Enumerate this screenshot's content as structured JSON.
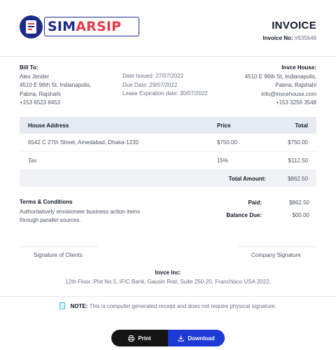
{
  "brand": {
    "name_dark": "SIM",
    "name_red": "ARSIP"
  },
  "invoice": {
    "title": "INVOICE",
    "number_label": "Invoice No:",
    "number": "#935648"
  },
  "bill_to": {
    "heading": "Bill To:",
    "lines": [
      "Alex Jender",
      "4510 E 96th St, Indianapolis,",
      "Pabna, Rajshahi",
      "+153 6523 8453"
    ]
  },
  "dates": {
    "lines": [
      "Date Issued: 27/07/2022",
      "Due Date: 29/07/2022",
      "Lease Expiration date: 30/07/2022"
    ]
  },
  "from": {
    "heading": "Invce House:",
    "lines": [
      "4510 E 96th St, Indianapolis,",
      "Pabna, Rajshahi",
      "info@invcehouse.com",
      "+153 3256 3548"
    ]
  },
  "table": {
    "headers": [
      "House Address",
      "Price",
      "Total"
    ],
    "rows": [
      [
        "6542 C 27th Street, Amedabad, Dhaka-1230",
        "$750.00",
        "$750.00"
      ],
      [
        "Tax",
        "15%",
        "$112.50"
      ]
    ],
    "total_label": "Total Amount:",
    "total_value": "$862.50"
  },
  "terms": {
    "heading": "Terms & Conditions",
    "body": "Authoritatively envisioneer business action items through parallel sources."
  },
  "payment": {
    "paid_label": "Paid:",
    "paid_value": "$862.50",
    "balance_label": "Balance Due:",
    "balance_value": "$00.00"
  },
  "signatures": {
    "client": "Signature of Clients",
    "company": "Company Signature"
  },
  "company": {
    "name": "Invce Inc:",
    "address": "12th Floor, Plot No.5, IFIC Bank, Gausin Rod, Suite 250-20, Franchisco USA 2022."
  },
  "note": {
    "label": "NOTE:",
    "text": "This is computer generated receipt and does not require physical signature."
  },
  "buttons": {
    "print": "Print",
    "download": "Download"
  },
  "colors": {
    "brand_blue": "#1e2a8a",
    "brand_red": "#e63946",
    "download_blue": "#1d3ad6",
    "print_black": "#141414"
  },
  "icons": {
    "print": "printer-icon",
    "download": "download-icon",
    "note": "document-icon"
  }
}
